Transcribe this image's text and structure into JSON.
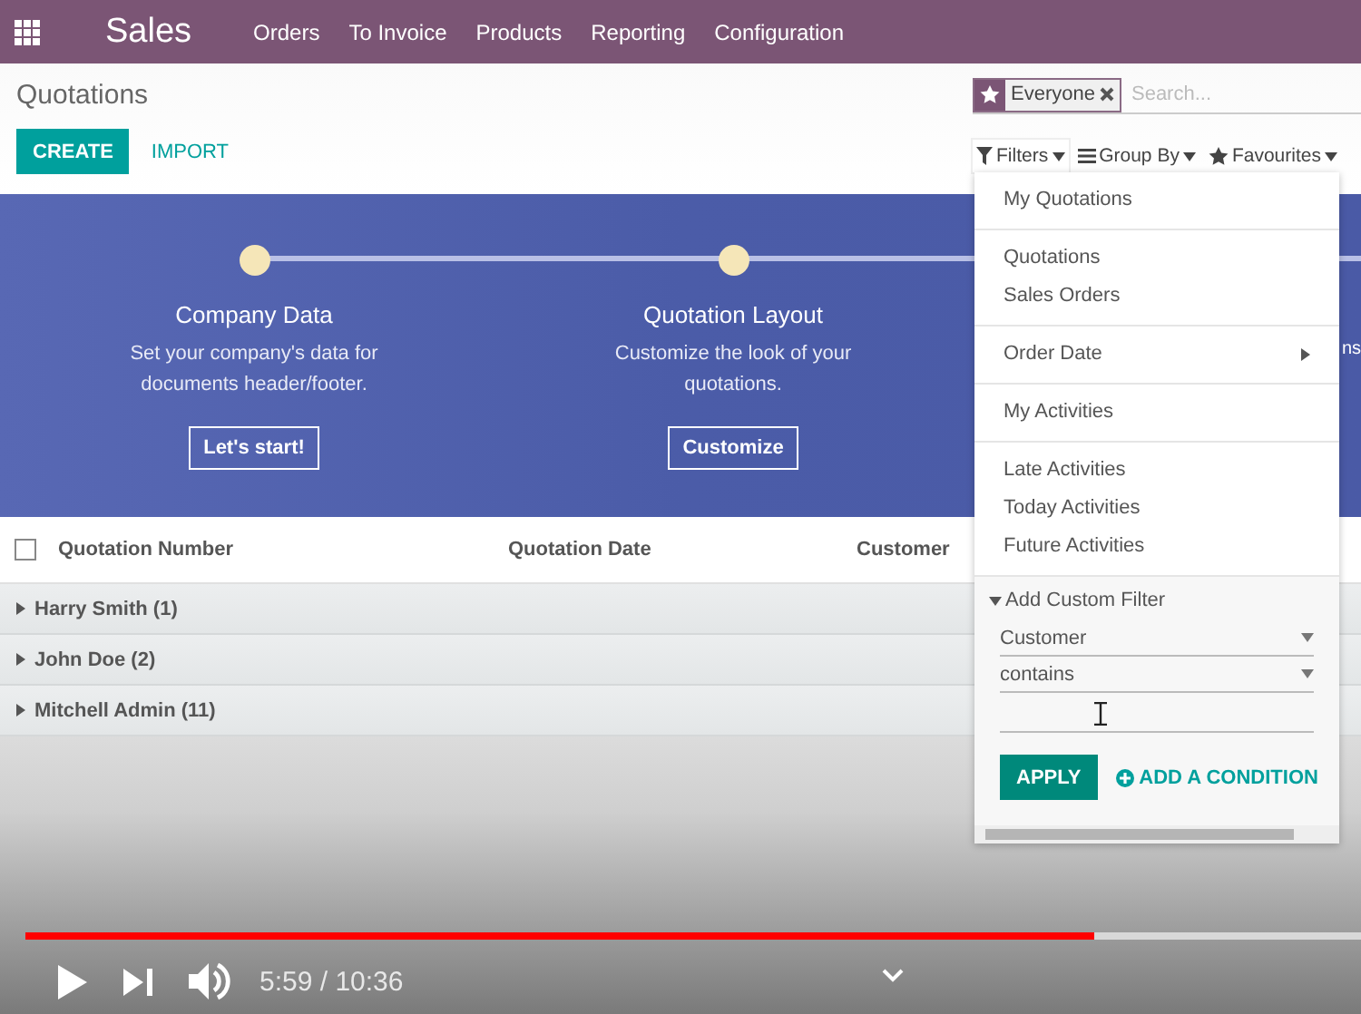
{
  "navbar": {
    "app_title": "Sales",
    "menu": [
      {
        "label": "Orders"
      },
      {
        "label": "To Invoice"
      },
      {
        "label": "Products"
      },
      {
        "label": "Reporting"
      },
      {
        "label": "Configuration"
      }
    ]
  },
  "control_panel": {
    "title": "Quotations",
    "buttons": [
      {
        "label": "CREATE",
        "kind": "primary"
      },
      {
        "label": "IMPORT",
        "kind": "link"
      }
    ],
    "search": {
      "facet": "Everyone",
      "placeholder": "Search..."
    },
    "options": [
      {
        "label": "Filters",
        "kind": "filter",
        "expanded": true
      },
      {
        "label": "Group By",
        "kind": "group",
        "expanded": false
      },
      {
        "label": "Favourites",
        "kind": "star",
        "expanded": false
      }
    ]
  },
  "banner": {
    "steps": [
      {
        "title": "Company Data",
        "description": "Set your company's data for documents header/footer.",
        "button": "Let's start!"
      },
      {
        "title": "Quotation Layout",
        "description": "Customize the look of your quotations.",
        "button": "Customize"
      }
    ],
    "covered_fragment": "ns"
  },
  "table": {
    "columns": [
      "Quotation Number",
      "Quotation Date",
      "Customer"
    ],
    "select_all": false,
    "groups": [
      {
        "label": "Harry Smith (1)",
        "expanded": false
      },
      {
        "label": "John Doe (2)",
        "expanded": false
      },
      {
        "label": "Mitchell Admin (11)",
        "expanded": false
      }
    ]
  },
  "filters_menu": {
    "sections": [
      [
        {
          "label": "My Quotations",
          "kind": "plain"
        }
      ],
      [
        {
          "label": "Quotations",
          "kind": "plain"
        },
        {
          "label": "Sales Orders",
          "kind": "plain"
        }
      ],
      [
        {
          "label": "Order Date",
          "kind": "submenu"
        }
      ],
      [
        {
          "label": "My Activities",
          "kind": "plain"
        }
      ],
      [
        {
          "label": "Late Activities",
          "kind": "plain"
        },
        {
          "label": "Today Activities",
          "kind": "plain"
        },
        {
          "label": "Future Activities",
          "kind": "plain"
        }
      ]
    ],
    "custom_filter": {
      "label": "Add Custom Filter",
      "expanded": true,
      "field": "Customer",
      "operator": "contains",
      "apply": "APPLY",
      "add_condition": "ADD A CONDITION"
    }
  },
  "video_player": {
    "playing": false,
    "level": 0.8,
    "time": "5:59 / 10:36"
  }
}
